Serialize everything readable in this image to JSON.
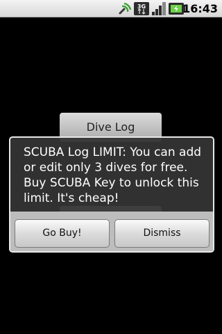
{
  "status_bar": {
    "time": "16:43",
    "network_type": "3G",
    "icons": [
      "sync-icon",
      "3g-data-icon",
      "signal-icon",
      "battery-charging-icon"
    ]
  },
  "background": {
    "primary_button_label": "Dive Log"
  },
  "dialog": {
    "message": "SCUBA Log LIMIT: You can add or edit only 3 dives for free. Buy SCUBA Key to unlock this limit. It's cheap!",
    "positive_label": "Go Buy!",
    "negative_label": "Dismiss"
  }
}
